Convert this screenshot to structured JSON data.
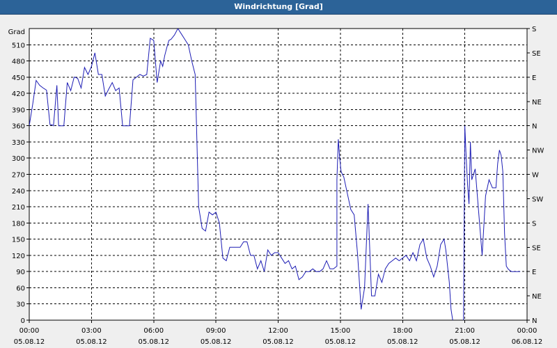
{
  "title": "Windrichtung [Grad]",
  "chart_data": {
    "type": "line",
    "title": "Windrichtung [Grad]",
    "ylabel": "Grad",
    "xlabel": "",
    "ylim": [
      0,
      540
    ],
    "xlim": [
      0,
      1440
    ],
    "grid": true,
    "y_ticks": [
      0,
      30,
      60,
      90,
      120,
      150,
      180,
      210,
      240,
      270,
      300,
      330,
      360,
      390,
      420,
      450,
      480,
      510
    ],
    "y2_ticks": [
      {
        "v": 0,
        "label": "N"
      },
      {
        "v": 45,
        "label": "NE"
      },
      {
        "v": 90,
        "label": "E"
      },
      {
        "v": 135,
        "label": "SE"
      },
      {
        "v": 180,
        "label": "S"
      },
      {
        "v": 225,
        "label": "SW"
      },
      {
        "v": 270,
        "label": "W"
      },
      {
        "v": 315,
        "label": "NW"
      },
      {
        "v": 360,
        "label": "N"
      },
      {
        "v": 405,
        "label": "NE"
      },
      {
        "v": 450,
        "label": "E"
      },
      {
        "v": 495,
        "label": "SE"
      },
      {
        "v": 540,
        "label": "S"
      }
    ],
    "x_ticks": [
      {
        "t": 0,
        "time": "00:00",
        "date": "05.08.12"
      },
      {
        "t": 180,
        "time": "03:00",
        "date": "05.08.12"
      },
      {
        "t": 360,
        "time": "06:00",
        "date": "05.08.12"
      },
      {
        "t": 540,
        "time": "09:00",
        "date": "05.08.12"
      },
      {
        "t": 720,
        "time": "12:00",
        "date": "05.08.12"
      },
      {
        "t": 900,
        "time": "15:00",
        "date": "05.08.12"
      },
      {
        "t": 1080,
        "time": "18:00",
        "date": "05.08.12"
      },
      {
        "t": 1260,
        "time": "21:00",
        "date": "05.08.12"
      },
      {
        "t": 1440,
        "time": "00:00",
        "date": "06.08.12"
      }
    ],
    "series": [
      {
        "color": "#1c1cb4",
        "x": [
          0,
          10,
          20,
          30,
          40,
          50,
          60,
          65,
          70,
          80,
          85,
          90,
          100,
          110,
          120,
          130,
          140,
          150,
          160,
          170,
          180,
          190,
          200,
          210,
          220,
          230,
          240,
          250,
          260,
          270,
          280,
          290,
          300,
          320,
          330,
          340,
          350,
          360,
          370,
          380,
          380,
          386,
          392,
          398,
          404,
          410,
          420,
          430,
          440,
          450,
          460,
          470,
          480,
          490,
          500,
          510,
          520,
          530,
          540,
          545,
          550,
          560,
          570,
          580,
          590,
          600,
          610,
          620,
          630,
          640,
          650,
          660,
          670,
          680,
          690,
          700,
          710,
          720,
          730,
          740,
          750,
          760,
          770,
          780,
          790,
          800,
          810,
          820,
          830,
          840,
          850,
          860,
          870,
          880,
          890,
          890,
          894,
          898,
          902,
          910,
          920,
          930,
          940,
          950,
          960,
          970,
          980,
          990,
          1000,
          1010,
          1020,
          1030,
          1040,
          1050,
          1060,
          1070,
          1080,
          1090,
          1100,
          1110,
          1120,
          1130,
          1140,
          1150,
          1160,
          1170,
          1180,
          1190,
          1200,
          1205,
          1210,
          1215,
          1220,
          1225,
          1230,
          1235,
          1240,
          1244,
          1248,
          1252,
          1256,
          1260,
          1264,
          1268,
          1272,
          1276,
          1280,
          1290,
          1300,
          1310,
          1320,
          1330,
          1340,
          1350,
          1355,
          1360,
          1365,
          1370,
          1375,
          1380,
          1385,
          1390,
          1395,
          1400,
          1405,
          1410,
          1415,
          1420
        ],
        "y": [
          360,
          400,
          444,
          435,
          430,
          426,
          362,
          362,
          360,
          435,
          360,
          360,
          360,
          440,
          425,
          450,
          448,
          430,
          468,
          455,
          470,
          495,
          455,
          455,
          415,
          428,
          440,
          425,
          430,
          360,
          360,
          360,
          445,
          455,
          452,
          455,
          522,
          518,
          440,
          480,
          480,
          470,
          490,
          505,
          518,
          520,
          528,
          540,
          530,
          520,
          510,
          480,
          455,
          210,
          170,
          165,
          200,
          195,
          200,
          190,
          180,
          115,
          110,
          135,
          135,
          135,
          135,
          145,
          145,
          120,
          120,
          95,
          110,
          90,
          130,
          120,
          125,
          125,
          115,
          105,
          110,
          95,
          100,
          75,
          80,
          90,
          90,
          95,
          90,
          90,
          95,
          110,
          95,
          95,
          100,
          260,
          335,
          300,
          275,
          265,
          235,
          205,
          195,
          120,
          20,
          60,
          215,
          45,
          45,
          85,
          70,
          95,
          105,
          110,
          115,
          110,
          115,
          120,
          110,
          125,
          110,
          140,
          150,
          115,
          100,
          80,
          100,
          140,
          150,
          130,
          100,
          70,
          20,
          0,
          -20,
          -20,
          -20,
          -20,
          -20,
          -20,
          -20,
          360,
          300,
          250,
          215,
          330,
          260,
          280,
          200,
          120,
          230,
          260,
          245,
          245,
          290,
          315,
          305,
          275,
          160,
          100,
          95,
          92,
          90,
          90,
          90,
          90,
          90,
          90
        ]
      }
    ]
  }
}
